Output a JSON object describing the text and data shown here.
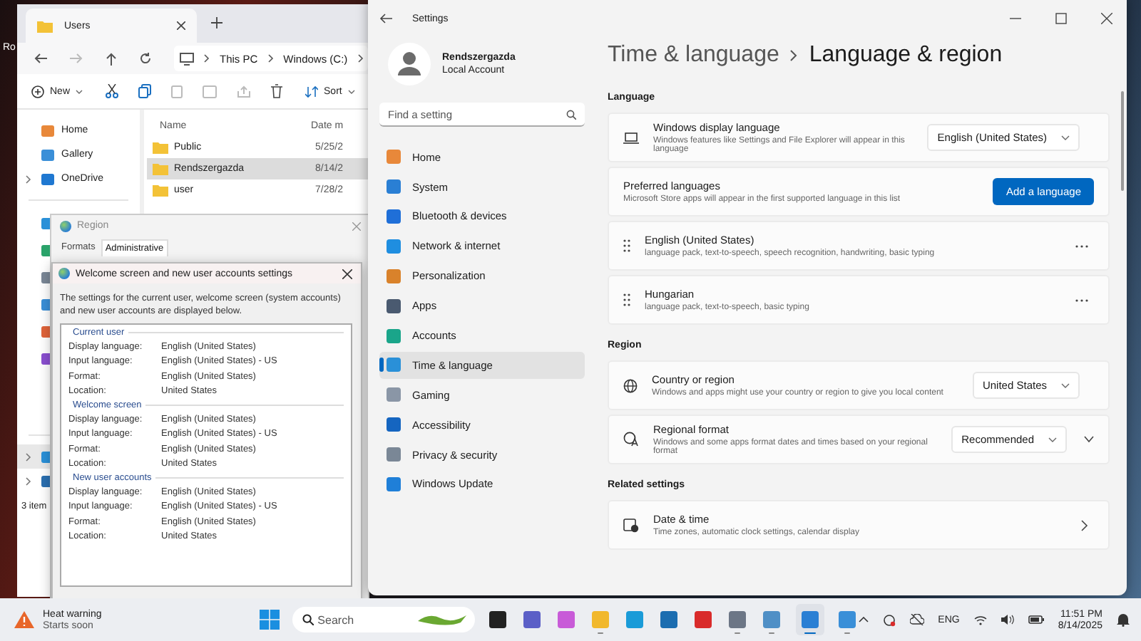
{
  "desktop": {
    "icon_label": "Ro"
  },
  "explorer": {
    "tab_title": "Users",
    "breadcrumb": [
      "This PC",
      "Windows (C:)"
    ],
    "new_label": "New",
    "sort_label": "Sort",
    "nav": [
      {
        "label": "Home",
        "expandable": false
      },
      {
        "label": "Gallery",
        "expandable": false
      },
      {
        "label": "OneDrive",
        "expandable": true
      }
    ],
    "columns": [
      "Name",
      "Date m"
    ],
    "files": [
      {
        "name": "Public",
        "date": "5/25/2",
        "selected": false
      },
      {
        "name": "Rendszergazda",
        "date": "8/14/2",
        "selected": true
      },
      {
        "name": "user",
        "date": "7/28/2",
        "selected": false
      }
    ],
    "status": "3 item"
  },
  "region": {
    "title": "Region",
    "tabs": [
      {
        "label": "Formats",
        "selected": false
      },
      {
        "label": "Administrative",
        "selected": true
      }
    ]
  },
  "welcome_dialog": {
    "title": "Welcome screen and new user accounts settings",
    "description": "The settings for the current user, welcome screen (system accounts) and new user accounts are displayed below.",
    "groups": [
      {
        "title": "Current user",
        "rows": [
          {
            "label": "Display language:",
            "value": "English (United States)"
          },
          {
            "label": "Input language:",
            "value": "English (United States) - US"
          },
          {
            "label": "Format:",
            "value": "English (United States)"
          },
          {
            "label": "Location:",
            "value": "United States"
          }
        ]
      },
      {
        "title": "Welcome screen",
        "rows": [
          {
            "label": "Display language:",
            "value": "English (United States)"
          },
          {
            "label": "Input language:",
            "value": "English (United States) - US"
          },
          {
            "label": "Format:",
            "value": "English (United States)"
          },
          {
            "label": "Location:",
            "value": "United States"
          }
        ]
      },
      {
        "title": "New user accounts",
        "rows": [
          {
            "label": "Display language:",
            "value": "English (United States)"
          },
          {
            "label": "Input language:",
            "value": "English (United States) - US"
          },
          {
            "label": "Format:",
            "value": "English (United States)"
          },
          {
            "label": "Location:",
            "value": "United States"
          }
        ]
      }
    ]
  },
  "settings": {
    "title": "Settings",
    "user": {
      "name": "Rendszergazda",
      "account": "Local Account"
    },
    "search": {
      "placeholder": "Find a setting"
    },
    "nav": [
      {
        "label": "Home",
        "selected": false
      },
      {
        "label": "System",
        "selected": false
      },
      {
        "label": "Bluetooth & devices",
        "selected": false
      },
      {
        "label": "Network & internet",
        "selected": false
      },
      {
        "label": "Personalization",
        "selected": false
      },
      {
        "label": "Apps",
        "selected": false
      },
      {
        "label": "Accounts",
        "selected": false
      },
      {
        "label": "Time & language",
        "selected": true
      },
      {
        "label": "Gaming",
        "selected": false
      },
      {
        "label": "Accessibility",
        "selected": false
      },
      {
        "label": "Privacy & security",
        "selected": false
      },
      {
        "label": "Windows Update",
        "selected": false
      }
    ],
    "breadcrumb": {
      "parent": "Time & language",
      "current": "Language & region"
    },
    "sections": [
      {
        "heading": "Language",
        "cards": [
          {
            "kind": "dropdown",
            "title": "Windows display language",
            "description": "Windows features like Settings and File Explorer will appear in this language",
            "value": "English (United States)",
            "expandable": false
          },
          {
            "kind": "button",
            "title": "Preferred languages",
            "description": "Microsoft Store apps will appear in the first supported language in this list",
            "action": "Add a language"
          },
          {
            "kind": "language",
            "title": "English (United States)",
            "description": "language pack, text-to-speech, speech recognition, handwriting, basic typing"
          },
          {
            "kind": "language",
            "title": "Hungarian",
            "description": "language pack, text-to-speech, basic typing"
          }
        ]
      },
      {
        "heading": "Region",
        "cards": [
          {
            "kind": "dropdown",
            "title": "Country or region",
            "description": "Windows and apps might use your country or region to give you local content",
            "value": "United States",
            "expandable": false
          },
          {
            "kind": "dropdown",
            "title": "Regional format",
            "description": "Windows and some apps format dates and times based on your regional format",
            "value": "Recommended",
            "expandable": true
          }
        ]
      },
      {
        "heading": "Related settings",
        "cards": [
          {
            "kind": "link",
            "title": "Date & time",
            "description": "Time zones, automatic clock settings, calendar display"
          }
        ]
      }
    ]
  },
  "taskbar": {
    "weather_title": "Heat warning",
    "weather_subtitle": "Starts soon",
    "search_placeholder": "Search",
    "apps": [
      {
        "running": false,
        "selected": false
      },
      {
        "running": false,
        "selected": false
      },
      {
        "running": false,
        "selected": false
      },
      {
        "running": true,
        "selected": false
      },
      {
        "running": false,
        "selected": false
      },
      {
        "running": false,
        "selected": false
      },
      {
        "running": false,
        "selected": false
      },
      {
        "running": true,
        "selected": false
      },
      {
        "running": true,
        "selected": false
      },
      {
        "running": true,
        "selected": true
      },
      {
        "running": true,
        "selected": false
      }
    ],
    "language": "ENG",
    "time": "11:51 PM",
    "date": "8/14/2025"
  }
}
